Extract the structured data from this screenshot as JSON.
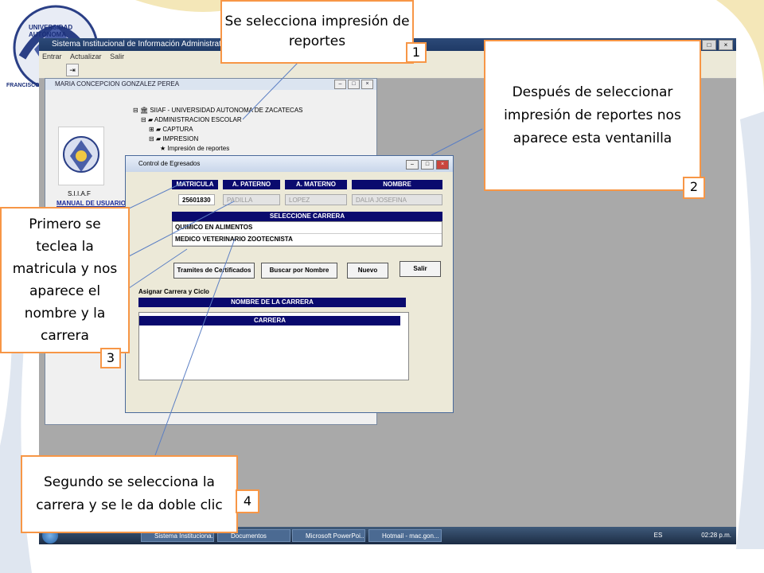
{
  "app": {
    "title": "Sistema Institucional de Información Administrativa y Financiera",
    "menu": [
      "Entrar",
      "Actualizar",
      "Salir"
    ]
  },
  "logo": {
    "text": "UNIVERSIDAD AUTÓNOMA",
    "sub": "FRANCISCO"
  },
  "siiaf_window": {
    "title": "MARIA CONCEPCION GONZALEZ PEREA",
    "app_name": "S.I.I.A.F",
    "manual_link": "MANUAL DE USUARIO",
    "tree": [
      "SIIAF - UNIVERSIDAD AUTONOMA DE ZACATECAS",
      "ADMINISTRACION ESCOLAR",
      "CAPTURA",
      "IMPRESION",
      "Impresión de reportes"
    ]
  },
  "dialog": {
    "title": "Control de Egresados",
    "headers": {
      "matricula": "MATRICULA",
      "paterno": "A. PATERNO",
      "materno": "A. MATERNO",
      "nombre": "NOMBRE"
    },
    "values": {
      "matricula": "25601830",
      "paterno": "PADILLA",
      "materno": "LOPEZ",
      "nombre": "DALIA JOSEFINA"
    },
    "carrera_header": "SELECCIONE CARRERA",
    "carreras": [
      "QUIMICO EN ALIMENTOS",
      "MEDICO VETERINARIO ZOOTECNISTA"
    ],
    "buttons": {
      "tramites": "Tramites de Certificados",
      "buscar": "Buscar por Nombre",
      "nuevo": "Nuevo",
      "salir": "Salir"
    },
    "asignar_label": "Asignar Carrera y Ciclo",
    "nombre_carrera_header": "NOMBRE DE LA CARRERA",
    "carrera_col_header": "CARRERA"
  },
  "taskbar": {
    "tasks": [
      "Sistema Instituciona...",
      "Documentos",
      "Microsoft PowerPoi...",
      "Hotmail - mac.gon..."
    ],
    "lang": "ES",
    "clock": "02:28 p.m."
  },
  "callouts": {
    "c1": {
      "text": "Se selecciona impresión de reportes",
      "num": "1"
    },
    "c2": {
      "text": "Después de seleccionar impresión de reportes nos aparece esta ventanilla",
      "num": "2"
    },
    "c3": {
      "text": "Primero se teclea la matricula y nos aparece el nombre y la carrera",
      "num": "3"
    },
    "c4": {
      "text": "Segundo se selecciona la carrera y se le da doble clic",
      "num": "4"
    }
  },
  "colors": {
    "callout_border": "#f79646",
    "header_navy": "#0a0a6e",
    "screen_gray": "#a9a9a9"
  }
}
